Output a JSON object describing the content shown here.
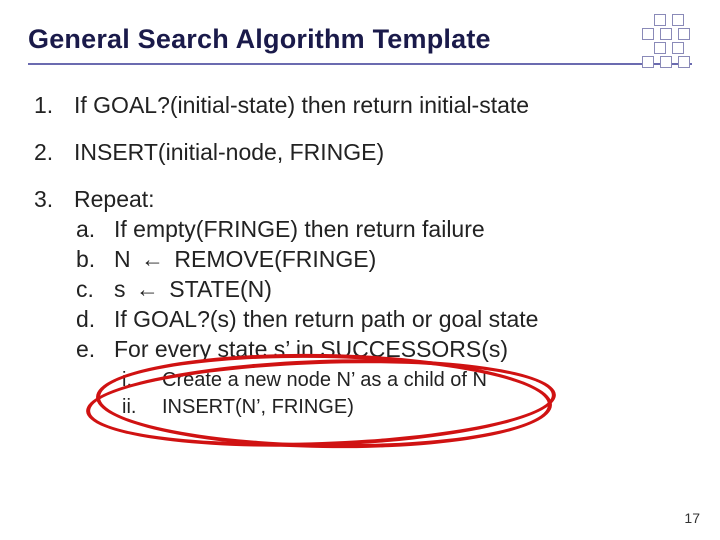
{
  "title": "General Search Algorithm Template",
  "steps": {
    "s1": "If GOAL?(initial-state) then return initial-state",
    "s2": "INSERT(initial-node, FRINGE)",
    "s3_head": "Repeat:",
    "a": "If empty(FRINGE) then return failure",
    "b_pre": "N ",
    "b_post": " REMOVE(FRINGE)",
    "c_pre": "s ",
    "c_post": " STATE(N)",
    "d": "If GOAL?(s) then return path or goal state",
    "e": "For every state s’ in SUCCESSORS(s)",
    "i": "Create a new node N’ as a child of N",
    "ii": "INSERT(N’, FRINGE)"
  },
  "arrow": "←",
  "pagenum": "17"
}
